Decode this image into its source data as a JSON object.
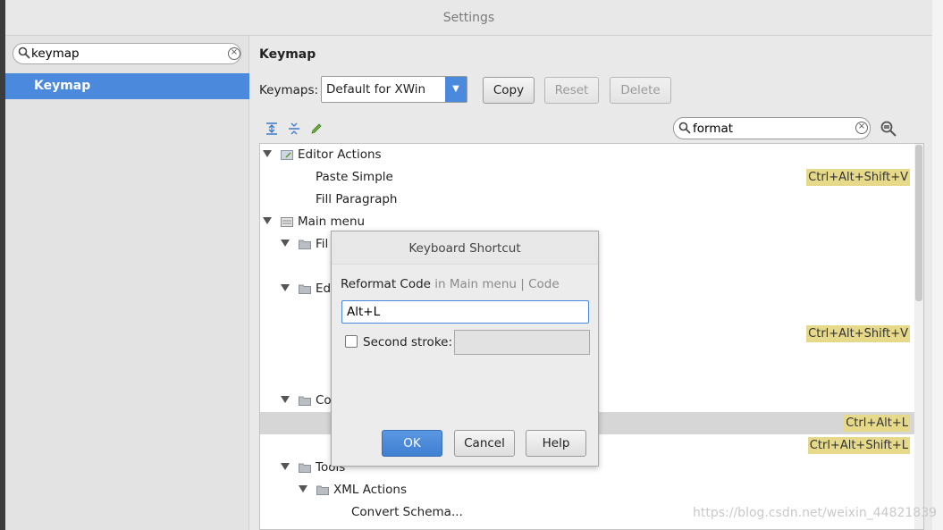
{
  "window": {
    "title": "Settings"
  },
  "sidebar": {
    "search_value": "keymap",
    "selected_item": "Keymap"
  },
  "main": {
    "title": "Keymap",
    "keymaps_label": "Keymaps:",
    "keymap_selected": "Default for XWin",
    "buttons": {
      "copy": "Copy",
      "reset": "Reset",
      "delete": "Delete"
    },
    "filter_value": "format"
  },
  "tree": {
    "rows": [
      {
        "label": "Editor Actions",
        "shortcut": ""
      },
      {
        "label": "Paste Simple",
        "shortcut": "Ctrl+Alt+Shift+V"
      },
      {
        "label": "Fill Paragraph",
        "shortcut": ""
      },
      {
        "label": "Main menu",
        "shortcut": ""
      },
      {
        "label": "Fil",
        "shortcut": ""
      },
      {
        "label": "Ed",
        "shortcut": ""
      },
      {
        "label": "",
        "shortcut": "Ctrl+Alt+Shift+V"
      },
      {
        "label": "Co",
        "shortcut": ""
      },
      {
        "label": "",
        "shortcut": "Ctrl+Alt+L"
      },
      {
        "label": "",
        "shortcut": "Ctrl+Alt+Shift+L"
      },
      {
        "label": "Tools",
        "shortcut": ""
      },
      {
        "label": "XML Actions",
        "shortcut": ""
      },
      {
        "label": "Convert Schema...",
        "shortcut": ""
      }
    ]
  },
  "dialog": {
    "title": "Keyboard Shortcut",
    "action_name": "Reformat Code",
    "action_path": "in Main menu | Code",
    "shortcut_value": "Alt+L",
    "second_stroke_label": "Second stroke:",
    "ok_label": "OK",
    "cancel_label": "Cancel",
    "help_label": "Help"
  },
  "watermark": "https://blog.csdn.net/weixin_44821839"
}
